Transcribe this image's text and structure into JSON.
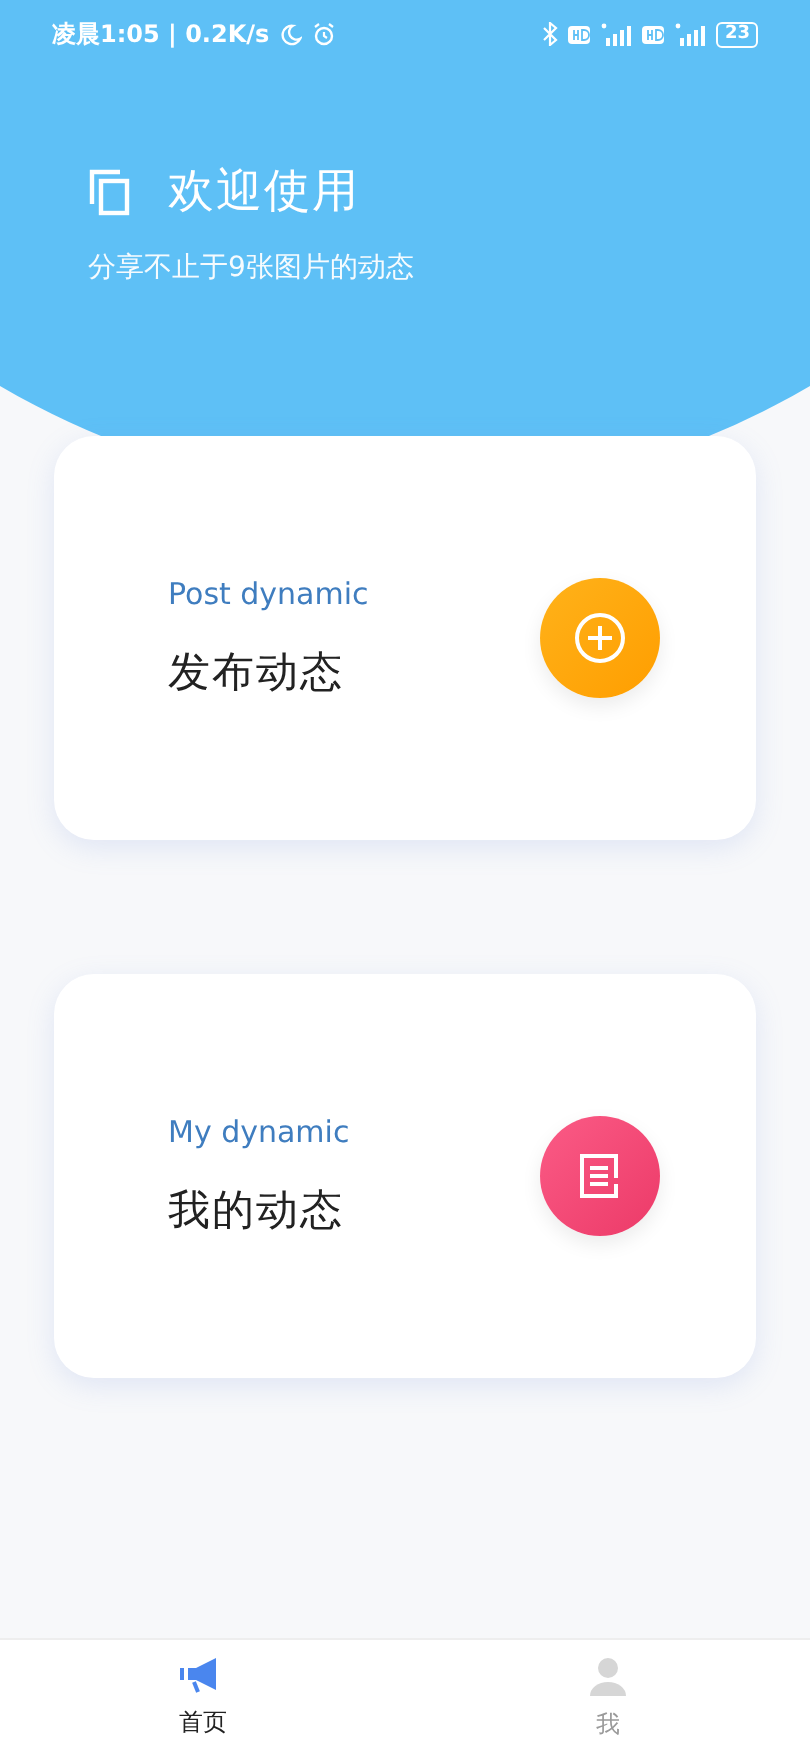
{
  "status_bar": {
    "time_speed": "凌晨1:05 | 0.2K/s",
    "battery": "23"
  },
  "header": {
    "title": "欢迎使用",
    "subtitle": "分享不止于9张图片的动态"
  },
  "cards": [
    {
      "kind": "post",
      "subtitle": "Post dynamic",
      "title": "发布动态"
    },
    {
      "kind": "mine",
      "subtitle": "My dynamic",
      "title": "我的动态"
    }
  ],
  "tabs": [
    {
      "kind": "home",
      "label": "首页",
      "selected": true
    },
    {
      "kind": "me",
      "label": "我",
      "selected": false
    }
  ]
}
